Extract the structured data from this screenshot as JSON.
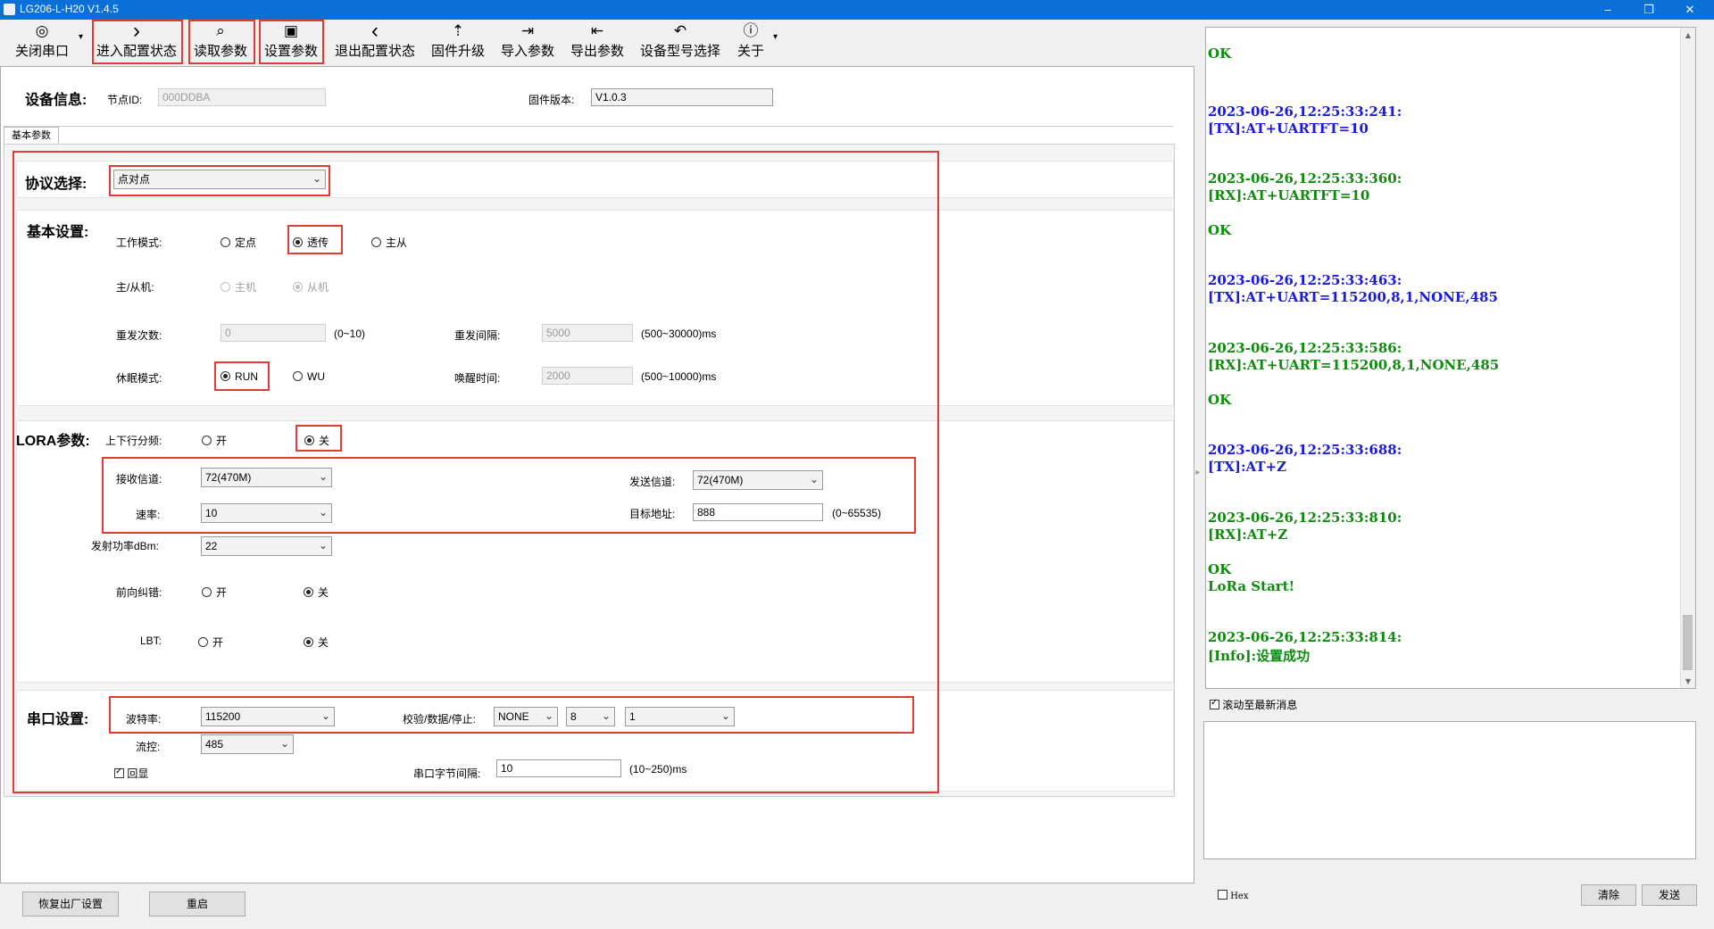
{
  "window": {
    "title": "LG206-L-H20 V1.4.5",
    "minimize": "–",
    "restore": "❐",
    "close": "✕"
  },
  "toolbar": {
    "items": [
      {
        "icon": "◎",
        "label": "关闭串口"
      },
      {
        "icon": "›",
        "label": "进入配置状态"
      },
      {
        "icon": "⌕",
        "label": "读取参数"
      },
      {
        "icon": "▣",
        "label": "设置参数"
      },
      {
        "icon": "‹",
        "label": "退出配置状态"
      },
      {
        "icon": "⇡",
        "label": "固件升级"
      },
      {
        "icon": "⇥",
        "label": "导入参数"
      },
      {
        "icon": "⇤",
        "label": "导出参数"
      },
      {
        "icon": "↶",
        "label": "设备型号选择"
      },
      {
        "icon": "ⓘ",
        "label": "关于"
      }
    ],
    "dropdown": "▾"
  },
  "device": {
    "heading": "设备信息:",
    "node_id_label": "节点ID:",
    "node_id_value": "000DDBA",
    "firmware_label": "固件版本:",
    "firmware_value": "V1.0.3"
  },
  "tab": {
    "label": "基本参数"
  },
  "protocol": {
    "label": "协议选择:",
    "value": "点对点"
  },
  "basic": {
    "heading": "基本设置:",
    "work_mode_label": "工作模式:",
    "work_modes": [
      "定点",
      "透传",
      "主从"
    ],
    "role_label": "主/从机:",
    "roles": [
      "主机",
      "从机"
    ],
    "retry_label": "重发次数:",
    "retry_value": "0",
    "retry_range": "(0~10)",
    "interval_label": "重发间隔:",
    "interval_value": "5000",
    "interval_range": "(500~30000)ms",
    "sleep_label": "休眠模式:",
    "sleep_modes": [
      "RUN",
      "WU"
    ],
    "wake_label": "唤醒时间:",
    "wake_value": "2000",
    "wake_range": "(500~10000)ms"
  },
  "lora": {
    "heading": "LORA参数:",
    "split_label": "上下行分频:",
    "on": "开",
    "off": "关",
    "rx_channel_label": "接收信道:",
    "rx_channel_value": "72(470M)",
    "tx_channel_label": "发送信道:",
    "tx_channel_value": "72(470M)",
    "rate_label": "速率:",
    "rate_value": "10",
    "target_label": "目标地址:",
    "target_value": "888",
    "target_range": "(0~65535)",
    "power_label": "发射功率dBm:",
    "power_value": "22",
    "fec_label": "前向纠错:",
    "lbt_label": "LBT:"
  },
  "serial": {
    "heading": "串口设置:",
    "baud_label": "波特率:",
    "baud_value": "115200",
    "parity_label": "校验/数据/停止:",
    "parity_value": "NONE",
    "data_value": "8",
    "stop_value": "1",
    "flow_label": "流控:",
    "flow_value": "485",
    "echo_label": "回显",
    "gap_label": "串口字节间隔:",
    "gap_value": "10",
    "gap_range": "(10~250)ms"
  },
  "bottom": {
    "factory_reset": "恢复出厂设置",
    "reboot": "重启"
  },
  "log": [
    {
      "t": "OK",
      "c": "green"
    },
    {
      "t": "2023-06-26,12:25:33:241:",
      "c": "blue"
    },
    {
      "t": "[TX]:AT+UARTFT=10",
      "c": "blue"
    },
    {
      "t": "2023-06-26,12:25:33:360:",
      "c": "green"
    },
    {
      "t": "[RX]:AT+UARTFT=10",
      "c": "green"
    },
    {
      "t": "OK",
      "c": "green"
    },
    {
      "t": "2023-06-26,12:25:33:463:",
      "c": "blue"
    },
    {
      "t": "[TX]:AT+UART=115200,8,1,NONE,485",
      "c": "blue"
    },
    {
      "t": "2023-06-26,12:25:33:586:",
      "c": "green"
    },
    {
      "t": "[RX]:AT+UART=115200,8,1,NONE,485",
      "c": "green"
    },
    {
      "t": "OK",
      "c": "green"
    },
    {
      "t": "2023-06-26,12:25:33:688:",
      "c": "blue"
    },
    {
      "t": "[TX]:AT+Z",
      "c": "blue"
    },
    {
      "t": "2023-06-26,12:25:33:810:",
      "c": "green"
    },
    {
      "t": "[RX]:AT+Z",
      "c": "green"
    },
    {
      "t": "OK",
      "c": "green"
    },
    {
      "t": "LoRa Start!",
      "c": "green"
    },
    {
      "t": "2023-06-26,12:25:33:814:",
      "c": "green"
    },
    {
      "t": "[Info]:设置成功",
      "c": "green"
    }
  ],
  "right": {
    "autoscroll_label": "滚动至最新消息",
    "hex_label": "Hex",
    "clear": "清除",
    "send": "发送",
    "scroll_up": "▲",
    "scroll_down": "▼",
    "splitter": "▸"
  }
}
